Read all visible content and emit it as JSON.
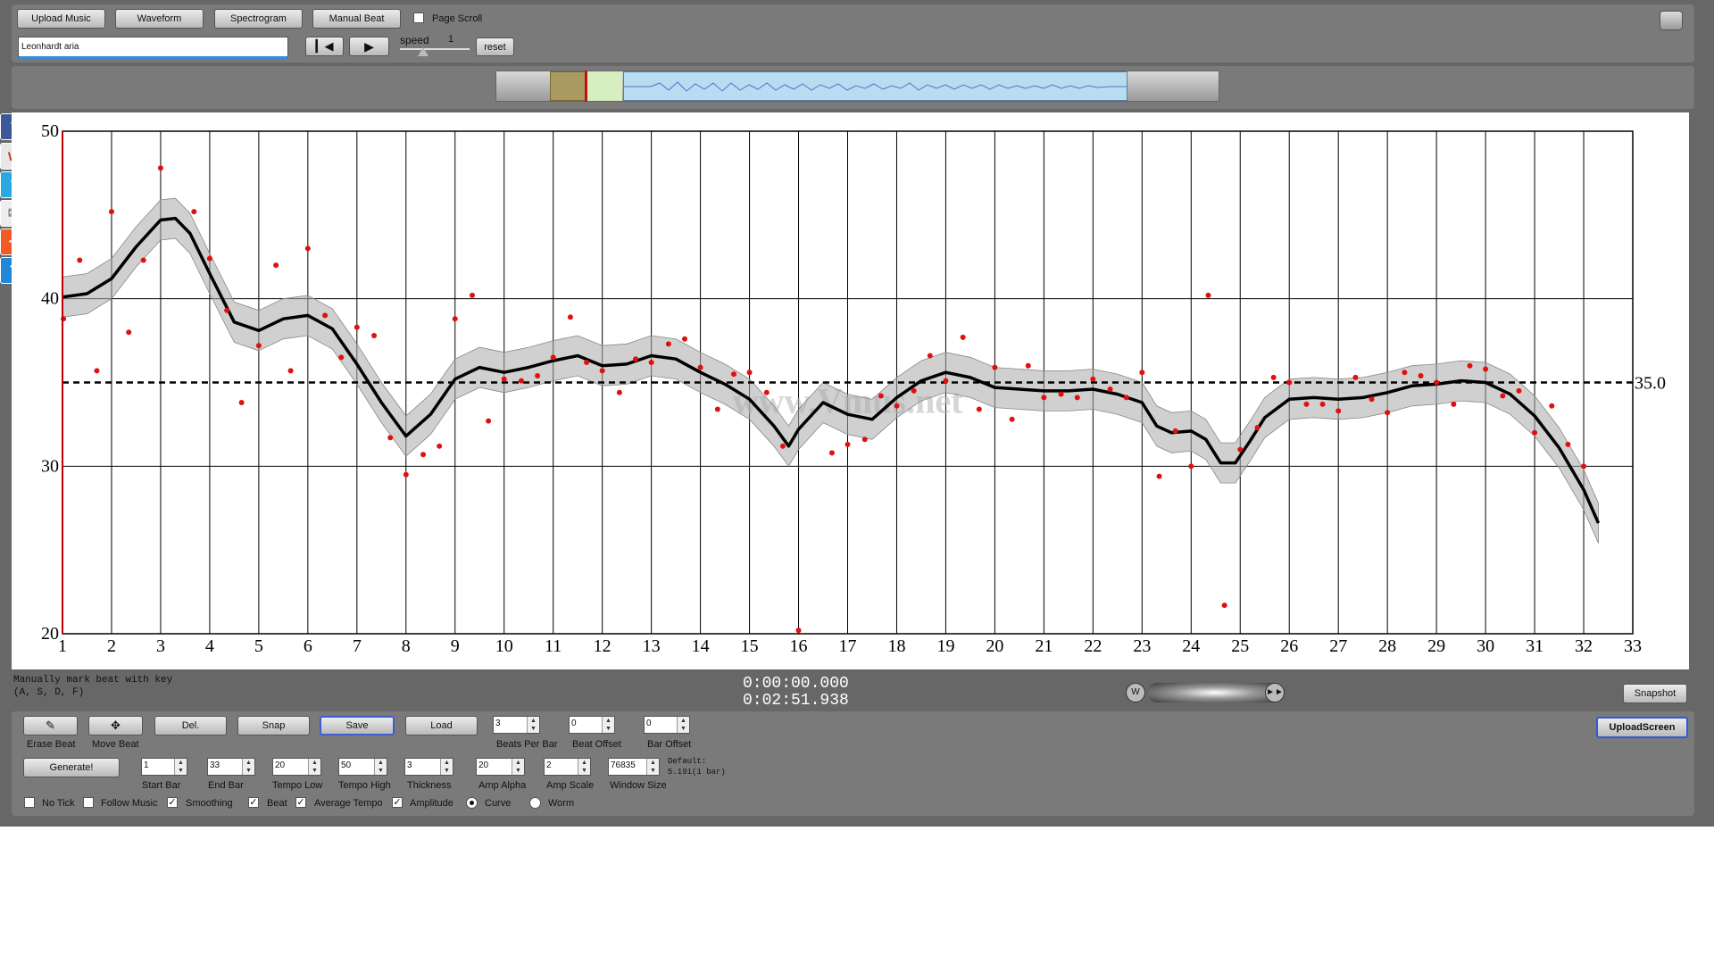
{
  "toolbar": {
    "upload_music": "Upload Music",
    "waveform": "Waveform",
    "spectrogram": "Spectrogram",
    "manual_beat": "Manual Beat",
    "page_scroll": "Page Scroll",
    "page_scroll_checked": false
  },
  "player": {
    "title_value": "Leonhardt aria",
    "speed_label": "speed",
    "speed_value": "1",
    "reset_label": "reset"
  },
  "social": [
    "facebook-icon",
    "weibo-icon",
    "twitter-icon",
    "email-icon",
    "share-plus-icon",
    "help-icon"
  ],
  "watermark": "www.Vmus.net",
  "status": {
    "instruction_line1": "Manually mark beat with key",
    "instruction_line2": "(A, S, D, F)",
    "current_time": "0:00:00.000",
    "total_time": "0:02:51.938",
    "snapshot": "Snapshot",
    "upload_screen": "UploadScreen"
  },
  "controls": {
    "erase_beat": "Erase Beat",
    "move_beat": "Move Beat",
    "del": "Del.",
    "snap": "Snap",
    "save": "Save",
    "load": "Load",
    "generate": "Generate!",
    "beats_per_bar": {
      "label": "Beats Per Bar",
      "value": "3"
    },
    "beat_offset": {
      "label": "Beat Offset",
      "value": "0"
    },
    "bar_offset": {
      "label": "Bar Offset",
      "value": "0"
    },
    "start_bar": {
      "label": "Start Bar",
      "value": "1"
    },
    "end_bar": {
      "label": "End Bar",
      "value": "33"
    },
    "tempo_low": {
      "label": "Tempo Low",
      "value": "20"
    },
    "tempo_high": {
      "label": "Tempo High",
      "value": "50"
    },
    "thickness": {
      "label": "Thickness",
      "value": "3"
    },
    "amp_alpha": {
      "label": "Amp Alpha",
      "value": "20"
    },
    "amp_scale": {
      "label": "Amp Scale",
      "value": "2"
    },
    "window_size": {
      "label": "Window Size",
      "value": "76835"
    },
    "default_line1": "Default:",
    "default_line2": "5.191(1 bar)",
    "checkboxes": [
      {
        "label": "No Tick",
        "checked": false
      },
      {
        "label": "Follow Music",
        "checked": false
      },
      {
        "label": "Smoothing",
        "checked": true
      },
      {
        "label": "Beat",
        "checked": true
      },
      {
        "label": "Average Tempo",
        "checked": true
      },
      {
        "label": "Amplitude",
        "checked": true
      }
    ],
    "radios": [
      {
        "label": "Curve",
        "selected": true
      },
      {
        "label": "Worm",
        "selected": false
      }
    ]
  },
  "chart_data": {
    "type": "scatter",
    "xlim": [
      1,
      33
    ],
    "ylim": [
      20,
      50
    ],
    "x_ticks": [
      1,
      2,
      3,
      4,
      5,
      6,
      7,
      8,
      9,
      10,
      11,
      12,
      13,
      14,
      15,
      16,
      17,
      18,
      19,
      20,
      21,
      22,
      23,
      24,
      25,
      26,
      27,
      28,
      29,
      30,
      31,
      32,
      33
    ],
    "y_ticks": [
      20,
      30,
      40,
      50
    ],
    "grid": "on",
    "average_line": {
      "value": 35.0,
      "label": "35.0"
    },
    "smooth_curve": {
      "x": [
        1,
        1.5,
        2,
        2.5,
        3,
        3.3,
        3.6,
        4,
        4.5,
        5,
        5.5,
        6,
        6.5,
        7,
        7.5,
        8,
        8.5,
        9,
        9.5,
        10,
        10.5,
        11,
        11.5,
        12,
        12.5,
        13,
        13.5,
        14,
        14.5,
        15,
        15.5,
        15.8,
        16,
        16.5,
        17,
        17.5,
        18,
        18.5,
        19,
        19.5,
        20,
        20.5,
        21,
        21.5,
        22,
        22.5,
        23,
        23.3,
        23.6,
        24,
        24.3,
        24.6,
        24.9,
        25.2,
        25.5,
        26,
        26.5,
        27,
        27.5,
        28,
        28.5,
        29,
        29.5,
        30,
        30.5,
        31,
        31.5,
        32,
        32.3
      ],
      "y": [
        40.1,
        40.3,
        41.2,
        43.1,
        44.7,
        44.8,
        43.9,
        41.5,
        38.6,
        38.1,
        38.8,
        39.0,
        38.2,
        36.1,
        33.8,
        31.8,
        33.1,
        35.2,
        35.9,
        35.6,
        35.9,
        36.3,
        36.6,
        36.0,
        36.1,
        36.6,
        36.4,
        35.6,
        34.9,
        34.0,
        32.4,
        31.2,
        32.2,
        33.8,
        33.1,
        32.8,
        34.1,
        35.1,
        35.6,
        35.3,
        34.7,
        34.6,
        34.5,
        34.5,
        34.6,
        34.3,
        33.8,
        32.4,
        32.0,
        32.1,
        31.6,
        30.2,
        30.2,
        31.5,
        32.9,
        34.0,
        34.1,
        34.0,
        34.1,
        34.4,
        34.8,
        34.9,
        35.1,
        35.0,
        34.3,
        33.0,
        31.1,
        28.6,
        26.6
      ]
    },
    "confidence_band_half_width": 1.2,
    "beat_points": [
      {
        "x": 1.02,
        "y": 38.8
      },
      {
        "x": 1.35,
        "y": 42.3
      },
      {
        "x": 1.7,
        "y": 35.7
      },
      {
        "x": 2.0,
        "y": 45.2
      },
      {
        "x": 2.35,
        "y": 38.0
      },
      {
        "x": 2.65,
        "y": 42.3
      },
      {
        "x": 3.0,
        "y": 47.8
      },
      {
        "x": 3.68,
        "y": 45.2
      },
      {
        "x": 4.0,
        "y": 42.4
      },
      {
        "x": 4.35,
        "y": 39.3
      },
      {
        "x": 4.65,
        "y": 33.8
      },
      {
        "x": 5.0,
        "y": 37.2
      },
      {
        "x": 5.35,
        "y": 42.0
      },
      {
        "x": 5.65,
        "y": 35.7
      },
      {
        "x": 6.0,
        "y": 43.0
      },
      {
        "x": 6.35,
        "y": 39.0
      },
      {
        "x": 6.68,
        "y": 36.5
      },
      {
        "x": 7.0,
        "y": 38.3
      },
      {
        "x": 7.35,
        "y": 37.8
      },
      {
        "x": 7.68,
        "y": 31.7
      },
      {
        "x": 8.0,
        "y": 29.5
      },
      {
        "x": 8.35,
        "y": 30.7
      },
      {
        "x": 8.68,
        "y": 31.2
      },
      {
        "x": 9.0,
        "y": 38.8
      },
      {
        "x": 9.35,
        "y": 40.2
      },
      {
        "x": 9.68,
        "y": 32.7
      },
      {
        "x": 10.0,
        "y": 35.2
      },
      {
        "x": 10.35,
        "y": 35.1
      },
      {
        "x": 10.68,
        "y": 35.4
      },
      {
        "x": 11.0,
        "y": 36.5
      },
      {
        "x": 11.35,
        "y": 38.9
      },
      {
        "x": 11.68,
        "y": 36.2
      },
      {
        "x": 12.0,
        "y": 35.7
      },
      {
        "x": 12.35,
        "y": 34.4
      },
      {
        "x": 12.68,
        "y": 36.4
      },
      {
        "x": 13.0,
        "y": 36.2
      },
      {
        "x": 13.35,
        "y": 37.3
      },
      {
        "x": 13.68,
        "y": 37.6
      },
      {
        "x": 14.0,
        "y": 35.9
      },
      {
        "x": 14.35,
        "y": 33.4
      },
      {
        "x": 14.68,
        "y": 35.5
      },
      {
        "x": 15.0,
        "y": 35.6
      },
      {
        "x": 15.35,
        "y": 34.4
      },
      {
        "x": 15.68,
        "y": 31.2
      },
      {
        "x": 16.0,
        "y": 20.2
      },
      {
        "x": 16.68,
        "y": 30.8
      },
      {
        "x": 17.0,
        "y": 31.3
      },
      {
        "x": 17.35,
        "y": 31.6
      },
      {
        "x": 17.68,
        "y": 34.2
      },
      {
        "x": 18.0,
        "y": 33.6
      },
      {
        "x": 18.35,
        "y": 34.5
      },
      {
        "x": 18.68,
        "y": 36.6
      },
      {
        "x": 19.0,
        "y": 35.1
      },
      {
        "x": 19.35,
        "y": 37.7
      },
      {
        "x": 19.68,
        "y": 33.4
      },
      {
        "x": 20.0,
        "y": 35.9
      },
      {
        "x": 20.35,
        "y": 32.8
      },
      {
        "x": 20.68,
        "y": 36.0
      },
      {
        "x": 21.0,
        "y": 34.1
      },
      {
        "x": 21.35,
        "y": 34.3
      },
      {
        "x": 21.68,
        "y": 34.1
      },
      {
        "x": 22.0,
        "y": 35.2
      },
      {
        "x": 22.35,
        "y": 34.6
      },
      {
        "x": 22.68,
        "y": 34.1
      },
      {
        "x": 23.0,
        "y": 35.6
      },
      {
        "x": 23.35,
        "y": 29.4
      },
      {
        "x": 23.68,
        "y": 32.1
      },
      {
        "x": 24.0,
        "y": 30.0
      },
      {
        "x": 24.35,
        "y": 40.2
      },
      {
        "x": 24.68,
        "y": 21.7
      },
      {
        "x": 25.0,
        "y": 31.0
      },
      {
        "x": 25.35,
        "y": 32.3
      },
      {
        "x": 25.68,
        "y": 35.3
      },
      {
        "x": 26.0,
        "y": 35.0
      },
      {
        "x": 26.35,
        "y": 33.7
      },
      {
        "x": 26.68,
        "y": 33.7
      },
      {
        "x": 27.0,
        "y": 33.3
      },
      {
        "x": 27.35,
        "y": 35.3
      },
      {
        "x": 27.68,
        "y": 34.0
      },
      {
        "x": 28.0,
        "y": 33.2
      },
      {
        "x": 28.35,
        "y": 35.6
      },
      {
        "x": 28.68,
        "y": 35.4
      },
      {
        "x": 29.0,
        "y": 35.0
      },
      {
        "x": 29.35,
        "y": 33.7
      },
      {
        "x": 29.68,
        "y": 36.0
      },
      {
        "x": 30.0,
        "y": 35.8
      },
      {
        "x": 30.35,
        "y": 34.2
      },
      {
        "x": 30.68,
        "y": 34.5
      },
      {
        "x": 31.0,
        "y": 32.0
      },
      {
        "x": 31.35,
        "y": 33.6
      },
      {
        "x": 31.68,
        "y": 31.3
      },
      {
        "x": 32.0,
        "y": 30.0
      }
    ]
  }
}
